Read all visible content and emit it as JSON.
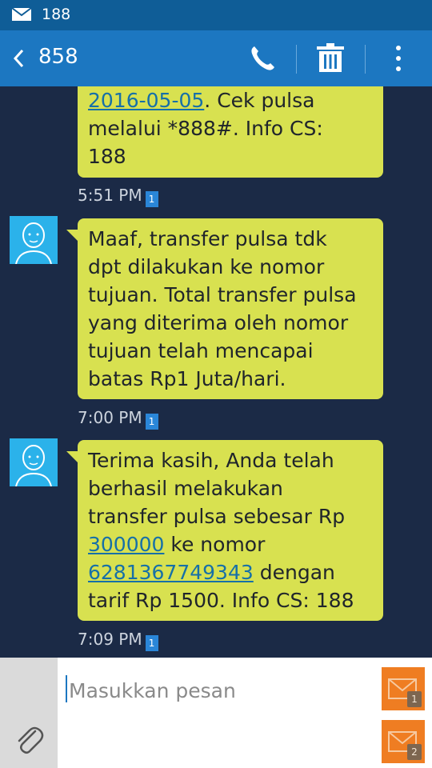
{
  "status_bar": {
    "notification_text": "188"
  },
  "header": {
    "title": "858"
  },
  "messages": [
    {
      "parts": [
        {
          "text": "2016-05-05",
          "link": true
        },
        {
          "text": ". Cek pulsa\nmelalui *888#. Info CS:\n188",
          "link": false
        }
      ],
      "time": "5:51 PM",
      "sim": "1"
    },
    {
      "parts": [
        {
          "text": "Maaf, transfer pulsa tdk\ndpt dilakukan ke nomor\ntujuan. Total transfer pulsa\nyang diterima oleh nomor\ntujuan telah mencapai\nbatas Rp1 Juta/hari.",
          "link": false
        }
      ],
      "time": "7:00 PM",
      "sim": "1"
    },
    {
      "parts": [
        {
          "text": "Terima kasih, Anda telah\nberhasil melakukan\ntransfer pulsa sebesar Rp\n",
          "link": false
        },
        {
          "text": "300000",
          "link": true
        },
        {
          "text": " ke nomor\n",
          "link": false
        },
        {
          "text": "6281367749343",
          "link": true
        },
        {
          "text": " dengan\ntarif Rp 1500. Info CS: 188",
          "link": false
        }
      ],
      "time": "7:09 PM",
      "sim": "1"
    }
  ],
  "composer": {
    "placeholder": "Masukkan pesan",
    "send_sim1_badge": "1",
    "send_sim2_badge": "2"
  },
  "colors": {
    "status_bar": "#0f5d97",
    "action_bar": "#1c77c1",
    "background": "#1b2a46",
    "bubble": "#d8e150",
    "link": "#1670a8",
    "avatar": "#2bb2ea",
    "send_button": "#ef7d22"
  },
  "icons": [
    "mail-icon",
    "back-icon",
    "phone-icon",
    "delete-icon",
    "more-icon",
    "avatar-icon",
    "sim-icon",
    "attach-icon",
    "send-icon"
  ]
}
